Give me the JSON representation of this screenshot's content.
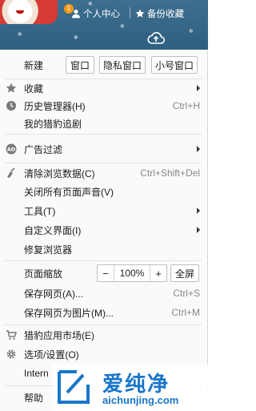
{
  "header": {
    "notification_count": "1",
    "profile_link": "个人中心",
    "bookmarks_link": "备份收藏",
    "tabs": [
      {
        "name": "menu-icon"
      },
      {
        "name": "cloud-upload-icon"
      }
    ]
  },
  "menu": {
    "new_row": {
      "label": "新建",
      "buttons": [
        "窗口",
        "隐私窗口",
        "小号窗口"
      ]
    },
    "items": [
      {
        "label": "收藏",
        "icon": "star-icon",
        "submenu": true
      },
      {
        "label": "历史管理器(H)",
        "icon": "clock-icon",
        "shortcut": "Ctrl+H"
      },
      {
        "label": "我的猎豹追剧"
      },
      {
        "label": "广告过滤",
        "icon": "ad-block-icon",
        "submenu": true
      },
      {
        "label": "清除浏览数据(C)",
        "icon": "broom-icon",
        "shortcut": "Ctrl+Shift+Del"
      },
      {
        "label": "关闭所有页面声音(V)"
      },
      {
        "label": "工具(T)",
        "submenu": true
      },
      {
        "label": "自定义界面(I)",
        "submenu": true
      },
      {
        "label": "修复浏览器"
      },
      {
        "label": "保存网页(A)...",
        "shortcut": "Ctrl+S"
      },
      {
        "label": "保存网页为图片(M)...",
        "shortcut": "Ctrl+M"
      },
      {
        "label": "猎豹应用市场(E)",
        "icon": "cart-icon"
      },
      {
        "label": "选项/设置(O)",
        "icon": "gear-icon"
      },
      {
        "label": "Intern"
      },
      {
        "label": "帮助"
      }
    ],
    "zoom": {
      "label": "页面缩放",
      "minus": "−",
      "value": "100%",
      "plus": "+",
      "fullscreen": "全屏"
    }
  },
  "watermark": {
    "text_cn": "爱纯净",
    "url": "aichunjing.com"
  }
}
